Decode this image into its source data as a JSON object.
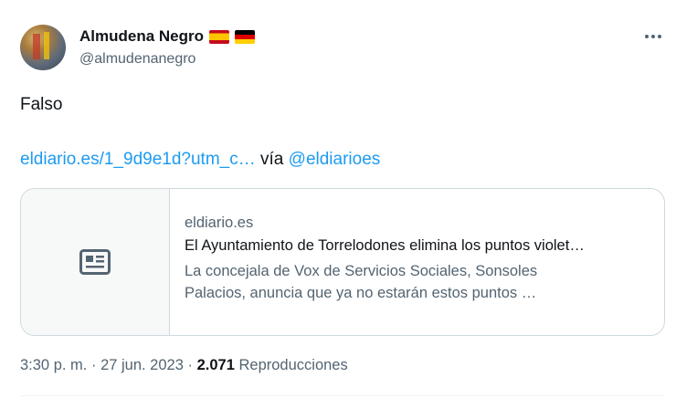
{
  "author": {
    "name": "Almudena Negro",
    "handle": "@almudenanegro",
    "flags": [
      "spain-flag",
      "germany-flag"
    ]
  },
  "tweet": {
    "text": "Falso",
    "link_text": "eldiario.es/1_9d9e1d?utm_c…",
    "via_text": "vía",
    "via_handle": "@eldiarioes"
  },
  "card": {
    "domain": "eldiario.es",
    "title": "El Ayuntamiento de Torrelodones elimina los puntos violet…",
    "description_line1": "La concejala de Vox de Servicios Sociales, Sonsoles",
    "description_line2": "Palacios, anuncia que ya no estarán estos puntos …"
  },
  "meta": {
    "time": "3:30 p. m.",
    "separator": "·",
    "date": "27 jun. 2023",
    "views_count": "2.071",
    "views_label": "Reproducciones"
  },
  "colors": {
    "link": "#1d9bf0",
    "secondary_text": "#536471",
    "primary_text": "#0f1419",
    "border": "#cfd9de"
  }
}
